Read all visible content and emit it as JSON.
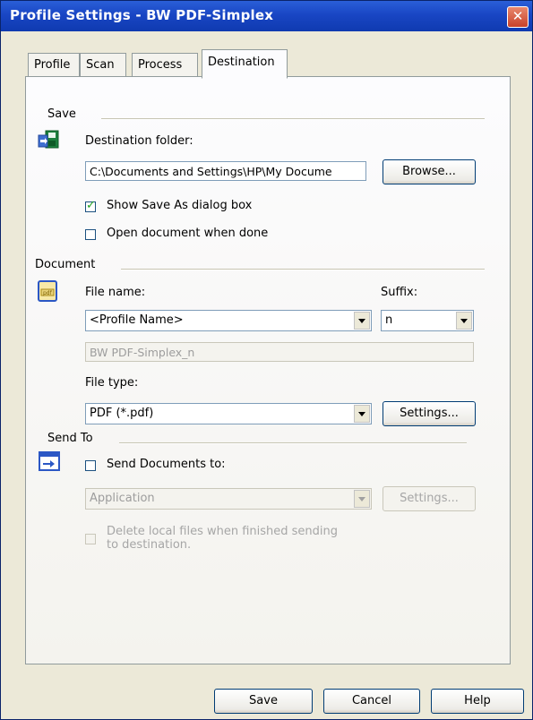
{
  "window": {
    "title": "Profile Settings - BW PDF-Simplex",
    "close_symbol": "✕"
  },
  "tabs": [
    {
      "label": "Profile"
    },
    {
      "label": "Scan"
    },
    {
      "label": "Process"
    },
    {
      "label": "Destination",
      "active": true
    }
  ],
  "save_section": {
    "heading": "Save",
    "destination_label": "Destination folder:",
    "destination_value": "C:\\Documents and Settings\\HP\\My Docume",
    "browse_label": "Browse...",
    "show_save_as_label": "Show Save As dialog box",
    "show_save_as_checked": true,
    "open_when_done_label": "Open document when done",
    "open_when_done_checked": false,
    "icon": "save-folder-icon"
  },
  "document_section": {
    "heading": "Document",
    "file_name_label": "File name:",
    "suffix_label": "Suffix:",
    "file_name_value": "<Profile Name>",
    "suffix_value": "n",
    "preview_value": "BW PDF-Simplex_n",
    "file_type_label": "File type:",
    "file_type_value": "PDF (*.pdf)",
    "settings_label": "Settings...",
    "icon": "pdf-document-icon"
  },
  "send_section": {
    "heading": "Send To",
    "send_label": "Send Documents to:",
    "send_checked": false,
    "application_value": "Application",
    "settings_label": "Settings...",
    "delete_label_line1": "Delete local files when finished sending",
    "delete_label_line2": "to destination.",
    "icon": "send-to-icon"
  },
  "footer": {
    "save_label": "Save",
    "cancel_label": "Cancel",
    "help_label": "Help"
  }
}
